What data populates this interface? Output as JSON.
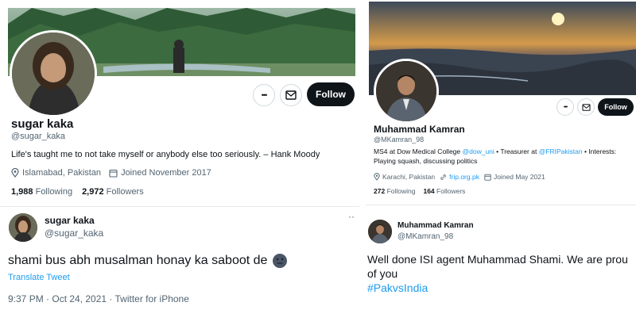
{
  "left_profile": {
    "name": "sugar kaka",
    "handle": "@sugar_kaka",
    "bio": "Life's taught me to not take myself or anybody else too seriously. – Hank Moody",
    "location": "Islamabad, Pakistan",
    "joined": "Joined November 2017",
    "following_count": "1,988",
    "following_label": "Following",
    "followers_count": "2,972",
    "followers_label": "Followers",
    "follow_label": "Follow",
    "more_label": "•••"
  },
  "left_tweet": {
    "name": "sugar kaka",
    "handle": "@sugar_kaka",
    "more_label": "··",
    "text": "shami bus abh musalman honay ka saboot de",
    "translate": "Translate Tweet",
    "timestamp": "9:37 PM · Oct 24, 2021 · Twitter for iPhone"
  },
  "right_profile": {
    "name": "Muhammad Kamran",
    "handle": "@MKamran_98",
    "bio_line1_a": "MS4 at Dow Medical College ",
    "bio_line1_link1": "@dow_uni",
    "bio_line1_b": " • Treasurer at ",
    "bio_line1_link2": "@FRIPakistan",
    "bio_line1_c": " • Interests:",
    "bio_line2": "Playing squash, discussing politics",
    "location": "Karachi, Pakistan",
    "website": "frip.org.pk",
    "joined": "Joined May 2021",
    "following_count": "272",
    "following_label": "Following",
    "followers_count": "164",
    "followers_label": "Followers",
    "follow_label": "Follow",
    "more_label": "•••"
  },
  "right_tweet": {
    "name": "Muhammad Kamran",
    "handle": "@MKamran_98",
    "text_line1": "Well done ISI agent Muhammad Shami. We are prou",
    "text_line2": "of you",
    "hashtag": "#PakvsIndia"
  },
  "colors": {
    "accent": "#1d9bf0",
    "text": "#0f1419",
    "secondary": "#536471",
    "follow_bg": "#0f1419"
  }
}
